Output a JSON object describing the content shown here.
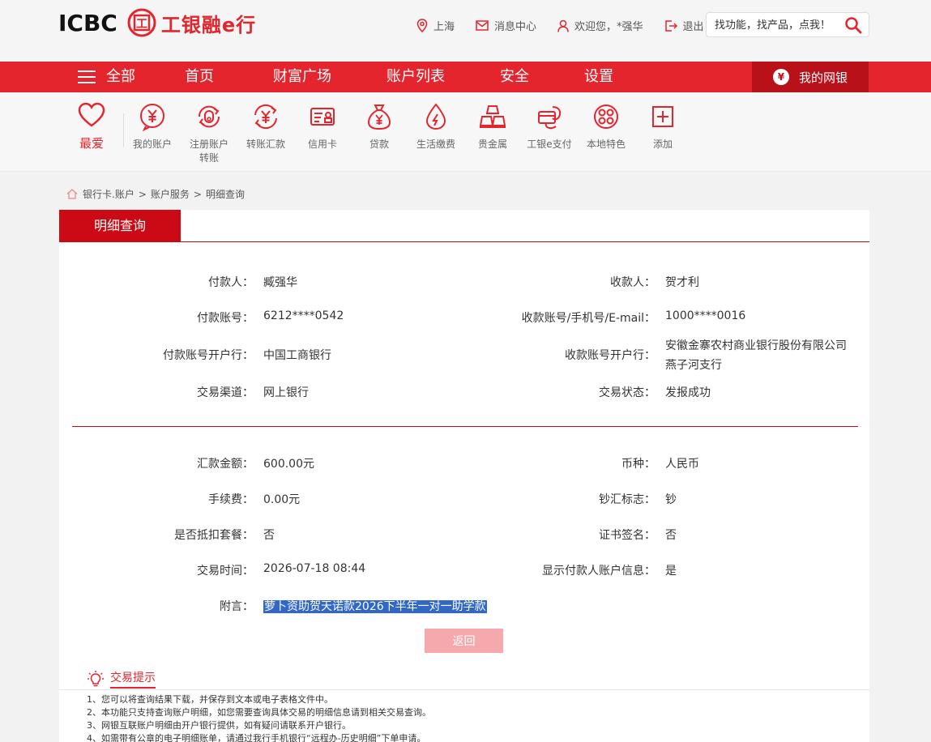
{
  "header": {
    "logo_text": "ICBC",
    "seal_glyph": "工",
    "brand_text": "工银融e行",
    "location": "上海",
    "messages": "消息中心",
    "welcome": "欢迎您，*强华",
    "logout": "退出",
    "search_placeholder": "找功能，找产品，点我！"
  },
  "nav": {
    "all": "全部",
    "items": [
      "首页",
      "财富广场",
      "账户列表",
      "安全",
      "设置"
    ],
    "my_bank": "我的网银",
    "my_bank_glyph": "¥"
  },
  "quick": {
    "fav_label": "最爱",
    "items": [
      {
        "label": "我的账户",
        "icon": "yen-chat-icon"
      },
      {
        "label": "注册账户转账",
        "icon": "transfer-icon"
      },
      {
        "label": "转账汇款",
        "icon": "remit-icon"
      },
      {
        "label": "信用卡",
        "icon": "credit-card-icon"
      },
      {
        "label": "贷款",
        "icon": "money-bag-icon"
      },
      {
        "label": "生活缴费",
        "icon": "utility-icon"
      },
      {
        "label": "贵金属",
        "icon": "gold-bar-icon"
      },
      {
        "label": "工银e支付",
        "icon": "epay-icon"
      },
      {
        "label": "本地特色",
        "icon": "local-icon"
      },
      {
        "label": "添加",
        "icon": "add-icon"
      }
    ]
  },
  "breadcrumb": [
    "银行卡.账户",
    "账户服务",
    "明细查询"
  ],
  "card": {
    "tab": "明细查询",
    "payer_label": "付款人：",
    "payer": "臧强华",
    "payee_label": "收款人：",
    "payee": "贺才利",
    "payer_acct_label": "付款账号：",
    "payer_acct": "6212****0542",
    "payee_acct_label": "收款账号/手机号/E-mail：",
    "payee_acct": "1000****0016",
    "payer_bank_label": "付款账号开户行：",
    "payer_bank": "中国工商银行",
    "payee_bank_label": "收款账号开户行：",
    "payee_bank_line1": "安徽金寨农村商业银行股份有限公司",
    "payee_bank_line2": "燕子河支行",
    "channel_label": "交易渠道：",
    "channel": "网上银行",
    "status_label": "交易状态：",
    "status": "发报成功",
    "amount_label": "汇款金额：",
    "amount": "600.00元",
    "currency_label": "币种：",
    "currency": "人民币",
    "fee_label": "手续费：",
    "fee": "0.00元",
    "cash_flag_label": "钞汇标志：",
    "cash_flag": "钞",
    "package_label": "是否抵扣套餐：",
    "package": "否",
    "cert_label": "证书签名：",
    "cert": "否",
    "time_label": "交易时间：",
    "time": "2026-07-18 08:44",
    "show_payer_label": "显示付款人账户信息：",
    "show_payer": "是",
    "remark_label": "附言：",
    "remark": "萝卜资助贺天诺款2026下半年一对一助学款",
    "back_button": "返回"
  },
  "tips": {
    "title": "交易提示",
    "items": [
      "1、您可以将查询结果下载，并保存到文本或电子表格文件中。",
      "2、本功能只支持查询账户明细，如您需要查询具体交易的明细信息请到相关交易查询。",
      "3、网银互联账户明细由开户银行提供，如有疑问请联系开户银行。",
      "4、如需带有公章的电子明细账单，请通过我行手机银行“远程办-历史明细”下单申请。"
    ]
  }
}
